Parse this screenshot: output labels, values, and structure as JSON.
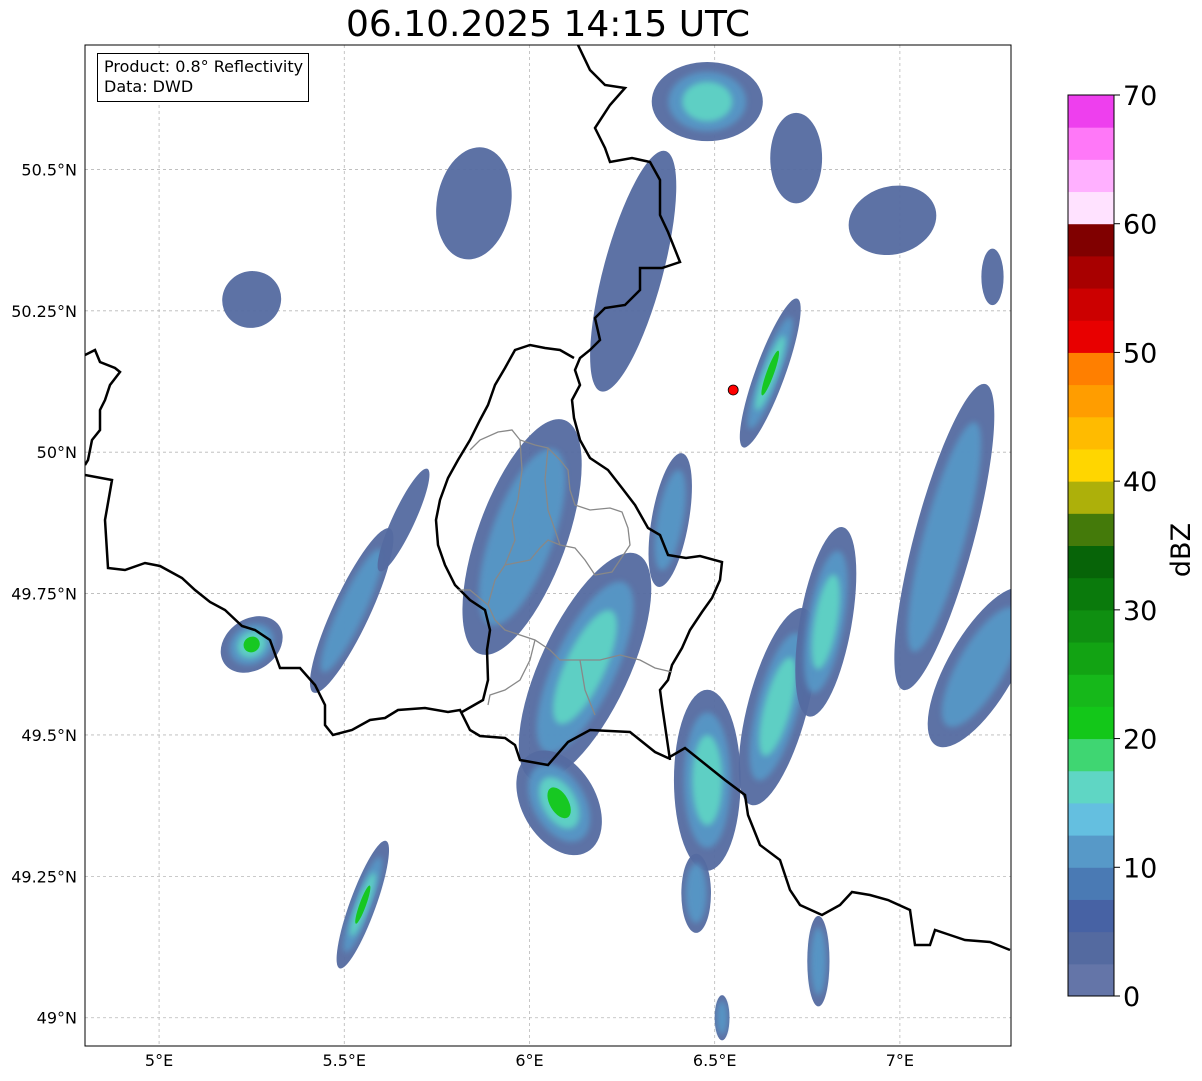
{
  "title": "06.10.2025 14:15 UTC",
  "info": {
    "product": "Product: 0.8° Reflectivity",
    "data": "Data: DWD"
  },
  "map": {
    "lon_range": [
      4.8,
      7.3
    ],
    "lat_range": [
      48.95,
      50.72
    ],
    "lon_ticks": [
      {
        "value": 5.0,
        "label": "5°E"
      },
      {
        "value": 5.5,
        "label": "5.5°E"
      },
      {
        "value": 6.0,
        "label": "6°E"
      },
      {
        "value": 6.5,
        "label": "6.5°E"
      },
      {
        "value": 7.0,
        "label": "7°E"
      }
    ],
    "lat_ticks": [
      {
        "value": 49.0,
        "label": "49°N"
      },
      {
        "value": 49.25,
        "label": "49.25°N"
      },
      {
        "value": 49.5,
        "label": "49.5°N"
      },
      {
        "value": 49.75,
        "label": "49.75°N"
      },
      {
        "value": 50.0,
        "label": "50°N"
      },
      {
        "value": 50.25,
        "label": "50.25°N"
      },
      {
        "value": 50.5,
        "label": "50.5°N"
      }
    ],
    "grid": true,
    "radar_site": {
      "lon": 6.55,
      "lat": 50.11,
      "color": "#ff0000"
    }
  },
  "colorbar": {
    "label": "dBZ",
    "min": 0,
    "max": 70,
    "ticks": [
      0,
      10,
      20,
      30,
      40,
      50,
      60,
      70
    ],
    "colors": [
      "#6475a8",
      "#546aa0",
      "#4762a4",
      "#4a7ab4",
      "#5799c8",
      "#64bfe0",
      "#5fd6c4",
      "#3fd672",
      "#13c719",
      "#16b81a",
      "#12a313",
      "#0f8f11",
      "#0a7a0c",
      "#076408",
      "#447a0a",
      "#adb00a",
      "#ffd600",
      "#ffbb00",
      "#ff9d00",
      "#ff7f00",
      "#e80000",
      "#cc0000",
      "#a80000",
      "#800000",
      "#ffe2ff",
      "#ffb0ff",
      "#ff78f8",
      "#ee3fee"
    ]
  },
  "rain_areas": [
    {
      "lon": 5.25,
      "lat": 49.66,
      "rlon": 0.09,
      "rlat": 0.045,
      "rot": -35,
      "level": 11
    },
    {
      "lon": 5.52,
      "lat": 49.72,
      "rlon": 0.05,
      "rlat": 0.16,
      "rot": 25,
      "level": 6
    },
    {
      "lon": 5.55,
      "lat": 49.2,
      "rlon": 0.035,
      "rlat": 0.12,
      "rot": 20,
      "level": 14
    },
    {
      "lon": 5.25,
      "lat": 50.27,
      "rlon": 0.08,
      "rlat": 0.05,
      "rot": -20,
      "level": 3
    },
    {
      "lon": 5.85,
      "lat": 50.44,
      "rlon": 0.1,
      "rlat": 0.1,
      "rot": 10,
      "level": 3
    },
    {
      "lon": 5.98,
      "lat": 49.85,
      "rlon": 0.12,
      "rlat": 0.22,
      "rot": 20,
      "level": 6
    },
    {
      "lon": 6.15,
      "lat": 49.62,
      "rlon": 0.12,
      "rlat": 0.22,
      "rot": 25,
      "level": 8
    },
    {
      "lon": 6.08,
      "lat": 49.38,
      "rlon": 0.1,
      "rlat": 0.1,
      "rot": -30,
      "level": 16
    },
    {
      "lon": 6.28,
      "lat": 50.32,
      "rlon": 0.08,
      "rlat": 0.22,
      "rot": 15,
      "level": 3
    },
    {
      "lon": 6.48,
      "lat": 50.62,
      "rlon": 0.15,
      "rlat": 0.07,
      "rot": 0,
      "level": 8
    },
    {
      "lon": 6.65,
      "lat": 50.14,
      "rlon": 0.04,
      "rlat": 0.14,
      "rot": 20,
      "level": 16
    },
    {
      "lon": 6.48,
      "lat": 49.42,
      "rlon": 0.09,
      "rlat": 0.16,
      "rot": 0,
      "level": 7
    },
    {
      "lon": 6.67,
      "lat": 49.55,
      "rlon": 0.08,
      "rlat": 0.18,
      "rot": 15,
      "level": 8
    },
    {
      "lon": 6.8,
      "lat": 49.7,
      "rlon": 0.07,
      "rlat": 0.17,
      "rot": 10,
      "level": 7
    },
    {
      "lon": 6.45,
      "lat": 49.22,
      "rlon": 0.04,
      "rlat": 0.07,
      "rot": 0,
      "level": 6
    },
    {
      "lon": 6.78,
      "lat": 49.1,
      "rlon": 0.03,
      "rlat": 0.08,
      "rot": 0,
      "level": 5
    },
    {
      "lon": 7.12,
      "lat": 49.85,
      "rlon": 0.08,
      "rlat": 0.28,
      "rot": 15,
      "level": 6
    },
    {
      "lon": 7.22,
      "lat": 49.62,
      "rlon": 0.09,
      "rlat": 0.16,
      "rot": 30,
      "level": 6
    },
    {
      "lon": 6.98,
      "lat": 50.41,
      "rlon": 0.12,
      "rlat": 0.06,
      "rot": -15,
      "level": 3
    },
    {
      "lon": 6.72,
      "lat": 50.52,
      "rlon": 0.07,
      "rlat": 0.08,
      "rot": 0,
      "level": 3
    },
    {
      "lon": 6.52,
      "lat": 49.0,
      "rlon": 0.02,
      "rlat": 0.04,
      "rot": 0,
      "level": 5
    },
    {
      "lon": 7.25,
      "lat": 50.31,
      "rlon": 0.03,
      "rlat": 0.05,
      "rot": 0,
      "level": 3
    },
    {
      "lon": 6.38,
      "lat": 49.88,
      "rlon": 0.05,
      "rlat": 0.12,
      "rot": 10,
      "level": 5
    },
    {
      "lon": 5.66,
      "lat": 49.88,
      "rlon": 0.03,
      "rlat": 0.1,
      "rot": 25,
      "level": 3
    }
  ]
}
